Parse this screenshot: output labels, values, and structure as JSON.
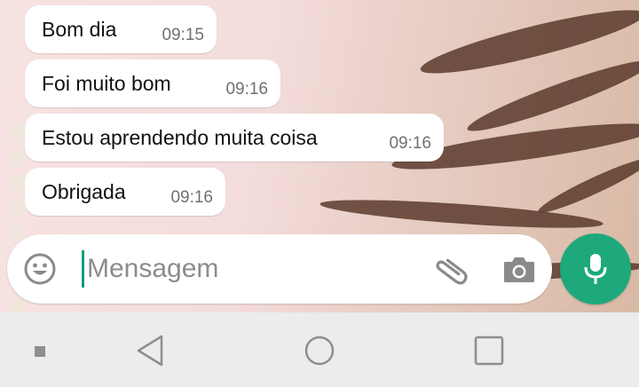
{
  "messages": [
    {
      "text": "Bom dia",
      "time": "09:15"
    },
    {
      "text": "Foi muito bom",
      "time": "09:16"
    },
    {
      "text": "Estou aprendendo muita coisa",
      "time": "09:16"
    },
    {
      "text": "Obrigada",
      "time": "09:16"
    }
  ],
  "composer": {
    "placeholder": "Mensagem",
    "value": "",
    "icons": [
      "emoji-icon",
      "paperclip-icon",
      "camera-icon"
    ]
  },
  "send_button": {
    "icon": "microphone-icon",
    "color": "#1da97c"
  },
  "navigation": {
    "icons": [
      "recents-dot-icon",
      "back-icon",
      "home-icon",
      "overview-icon"
    ]
  },
  "colors": {
    "accent": "#1da97c",
    "bubble": "#ffffff",
    "timestamp": "#707070"
  }
}
